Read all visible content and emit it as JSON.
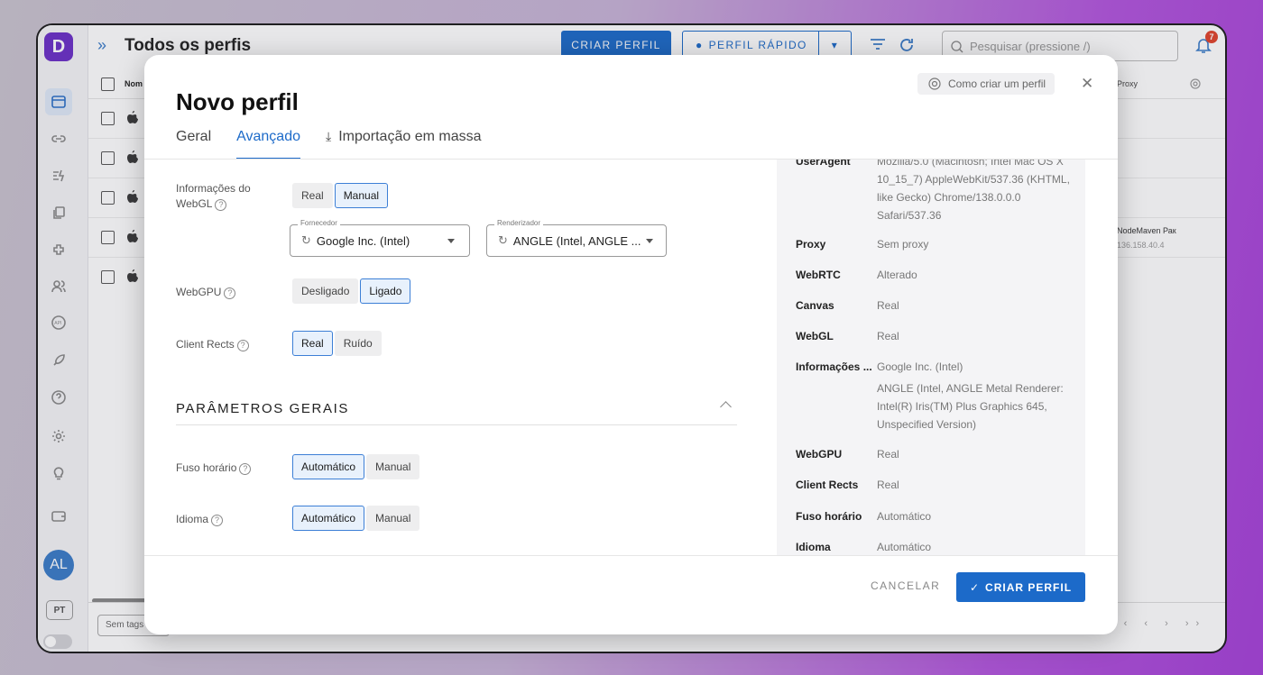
{
  "app": {
    "logo_letter": "D",
    "page_title": "Todos os perfis",
    "create_profile_label": "CRIAR PERFIL",
    "quick_profile_label": "PERFIL RÁPIDO",
    "search_placeholder": "Pesquisar (pressione /)",
    "notification_count": "7",
    "avatar_initials": "AL",
    "language": "PT",
    "sidebar_icons": [
      "browser-icon",
      "link-icon",
      "automation-icon",
      "copy-icon",
      "extensions-icon",
      "users-icon",
      "api-icon",
      "rocket-icon",
      "help-icon",
      "settings-icon",
      "lightbulb-icon",
      "wallet-icon"
    ]
  },
  "table": {
    "col_name": "Nom",
    "col_proxy": "Proxy",
    "rows": [
      {
        "proxy_name": "",
        "proxy_ip": ""
      },
      {
        "proxy_name": "",
        "proxy_ip": ""
      },
      {
        "proxy_name": "",
        "proxy_ip": ""
      },
      {
        "proxy_name": "NodeMaven Рак",
        "proxy_ip": "136.158.40.4"
      },
      {
        "proxy_name": "",
        "proxy_ip": ""
      }
    ],
    "tags_button": "Sem tags"
  },
  "modal": {
    "title": "Novo perfil",
    "help_link": "Como criar um perfil",
    "tabs": [
      "Geral",
      "Avançado",
      "Importação em massa"
    ],
    "active_tab": "Avançado",
    "webgl_info": {
      "label": "Informações do WebGL",
      "options": [
        "Real",
        "Manual"
      ],
      "selected": "Manual",
      "vendor_legend": "Fornecedor",
      "vendor_value": "Google Inc. (Intel)",
      "renderer_legend": "Renderizador",
      "renderer_value": "ANGLE (Intel, ANGLE ..."
    },
    "webgpu": {
      "label": "WebGPU",
      "options": [
        "Desligado",
        "Ligado"
      ],
      "selected": "Ligado"
    },
    "client_rects": {
      "label": "Client Rects",
      "options": [
        "Real",
        "Ruído"
      ],
      "selected": "Real"
    },
    "section_general": "PARÂMETROS GERAIS",
    "timezone": {
      "label": "Fuso horário",
      "options": [
        "Automático",
        "Manual"
      ],
      "selected": "Automático"
    },
    "language": {
      "label": "Idioma",
      "options": [
        "Automático",
        "Manual"
      ],
      "selected": "Automático"
    },
    "summary": [
      {
        "key": "UserAgent",
        "value": "Mozilla/5.0 (Macintosh; Intel Mac OS X 10_15_7) AppleWebKit/537.36 (KHTML, like Gecko) Chrome/138.0.0.0 Safari/537.36"
      },
      {
        "key": "Proxy",
        "value": "Sem proxy"
      },
      {
        "key": "WebRTC",
        "value": "Alterado"
      },
      {
        "key": "Canvas",
        "value": "Real"
      },
      {
        "key": "WebGL",
        "value": "Real"
      },
      {
        "key": "Informações ...",
        "value": "Google Inc. (Intel)"
      },
      {
        "key": "",
        "value": "ANGLE (Intel, ANGLE Metal Renderer: Intel(R) Iris(TM) Plus Graphics 645, Unspecified Version)"
      },
      {
        "key": "WebGPU",
        "value": "Real"
      },
      {
        "key": "Client Rects",
        "value": "Real"
      },
      {
        "key": "Fuso horário",
        "value": "Automático"
      },
      {
        "key": "Idioma",
        "value": "Automático"
      }
    ],
    "cancel_label": "CANCELAR",
    "create_label": "CRIAR PERFIL"
  },
  "colors": {
    "accent": "#1c6ac9",
    "brand": "#6a2fc6",
    "badge": "#e0432b"
  }
}
